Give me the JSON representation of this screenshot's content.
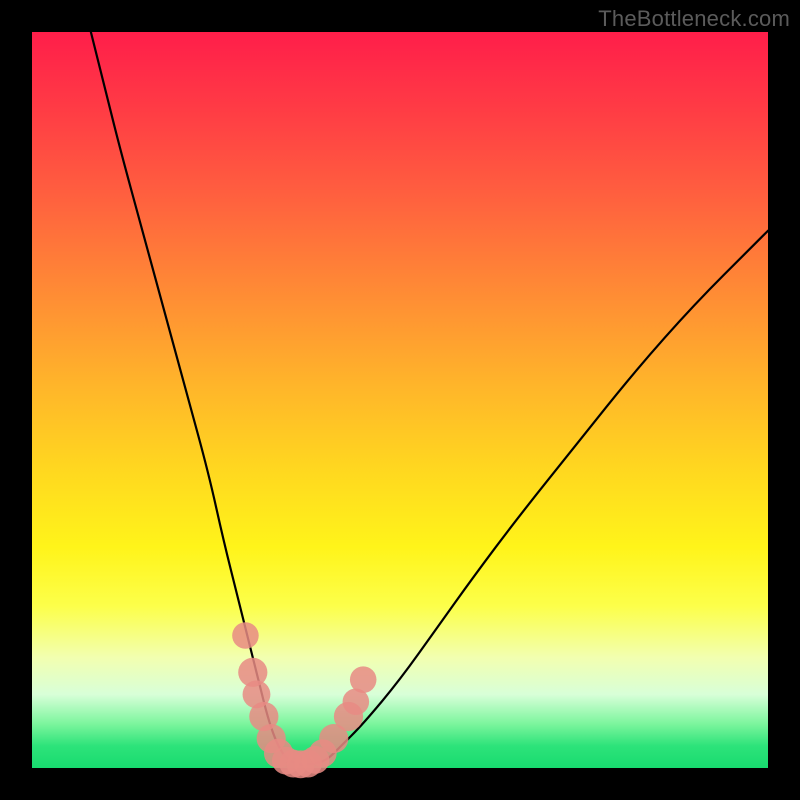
{
  "watermark": "TheBottleneck.com",
  "chart_data": {
    "type": "line",
    "title": "",
    "xlabel": "",
    "ylabel": "",
    "xlim": [
      0,
      100
    ],
    "ylim": [
      0,
      100
    ],
    "series": [
      {
        "name": "bottleneck-curve",
        "x": [
          8,
          10,
          12,
          15,
          18,
          21,
          24,
          26,
          28,
          30,
          31,
          32,
          33,
          34,
          35,
          36,
          38,
          40,
          42,
          45,
          50,
          55,
          60,
          66,
          74,
          82,
          90,
          98,
          100
        ],
        "values": [
          100,
          92,
          84,
          73,
          62,
          51,
          40,
          31,
          23,
          15,
          11,
          7,
          4,
          2,
          1,
          0.5,
          0.5,
          1,
          3,
          6,
          12,
          19,
          26,
          34,
          44,
          54,
          63,
          71,
          73
        ]
      }
    ],
    "markers": {
      "name": "highlighted-points",
      "color": "#e88b84",
      "points": [
        {
          "x": 29,
          "y": 18,
          "r": 1.4
        },
        {
          "x": 30,
          "y": 13,
          "r": 1.6
        },
        {
          "x": 30.5,
          "y": 10,
          "r": 1.5
        },
        {
          "x": 31.5,
          "y": 7,
          "r": 1.6
        },
        {
          "x": 32.5,
          "y": 4,
          "r": 1.6
        },
        {
          "x": 33.5,
          "y": 2,
          "r": 1.6
        },
        {
          "x": 34.5,
          "y": 1,
          "r": 1.5
        },
        {
          "x": 35.5,
          "y": 0.6,
          "r": 1.5
        },
        {
          "x": 36.5,
          "y": 0.5,
          "r": 1.5
        },
        {
          "x": 37.5,
          "y": 0.6,
          "r": 1.5
        },
        {
          "x": 38.5,
          "y": 1.1,
          "r": 1.5
        },
        {
          "x": 39.5,
          "y": 2,
          "r": 1.5
        },
        {
          "x": 41,
          "y": 4,
          "r": 1.6
        },
        {
          "x": 43,
          "y": 7,
          "r": 1.6
        },
        {
          "x": 44,
          "y": 9,
          "r": 1.4
        },
        {
          "x": 45,
          "y": 12,
          "r": 1.4
        }
      ]
    }
  }
}
